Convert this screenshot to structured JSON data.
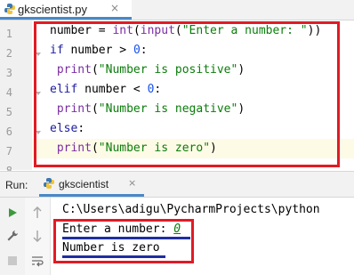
{
  "editor_tab": {
    "filename": "gkscientist.py",
    "close": "×"
  },
  "code": {
    "line_numbers": [
      "1",
      "2",
      "3",
      "4",
      "5",
      "6",
      "7",
      "8"
    ],
    "lines": [
      {
        "parts": [
          {
            "t": "number = ",
            "c": "fn"
          },
          {
            "t": "int",
            "c": "bi"
          },
          {
            "t": "(",
            "c": "fn"
          },
          {
            "t": "input",
            "c": "bi"
          },
          {
            "t": "(",
            "c": "fn"
          },
          {
            "t": "\"Enter a number: \"",
            "c": "str"
          },
          {
            "t": "))",
            "c": "fn"
          }
        ]
      },
      {
        "parts": [
          {
            "t": "if",
            "c": "kw"
          },
          {
            "t": " number > ",
            "c": "fn"
          },
          {
            "t": "0",
            "c": "num"
          },
          {
            "t": ":",
            "c": "fn"
          }
        ]
      },
      {
        "parts": [
          {
            "t": " print",
            "c": "bi"
          },
          {
            "t": "(",
            "c": "fn"
          },
          {
            "t": "\"Number is positive\"",
            "c": "str"
          },
          {
            "t": ")",
            "c": "fn"
          }
        ]
      },
      {
        "parts": [
          {
            "t": "elif",
            "c": "kw"
          },
          {
            "t": " number < ",
            "c": "fn"
          },
          {
            "t": "0",
            "c": "num"
          },
          {
            "t": ":",
            "c": "fn"
          }
        ]
      },
      {
        "parts": [
          {
            "t": " print",
            "c": "bi"
          },
          {
            "t": "(",
            "c": "fn"
          },
          {
            "t": "\"Number is negative\"",
            "c": "str"
          },
          {
            "t": ")",
            "c": "fn"
          }
        ]
      },
      {
        "parts": [
          {
            "t": "else",
            "c": "kw"
          },
          {
            "t": ":",
            "c": "fn"
          }
        ]
      },
      {
        "parts": [
          {
            "t": " print",
            "c": "bi"
          },
          {
            "t": "(",
            "c": "fn"
          },
          {
            "t": "\"Number is zero\"",
            "c": "str"
          },
          {
            "t": ")",
            "c": "fn"
          }
        ]
      }
    ]
  },
  "run_panel": {
    "label": "Run:",
    "tab_title": "gkscientist",
    "close": "×",
    "command_path": "C:\\Users\\adigu\\PycharmProjects\\python",
    "prompt": "Enter a number: ",
    "input_value": "0",
    "result": "Number is zero"
  },
  "colors": {
    "highlight_box": "#e01b24",
    "underline": "#1f2fa0",
    "tab_accent": "#4a88c7",
    "run_green": "#3c9a3c"
  }
}
